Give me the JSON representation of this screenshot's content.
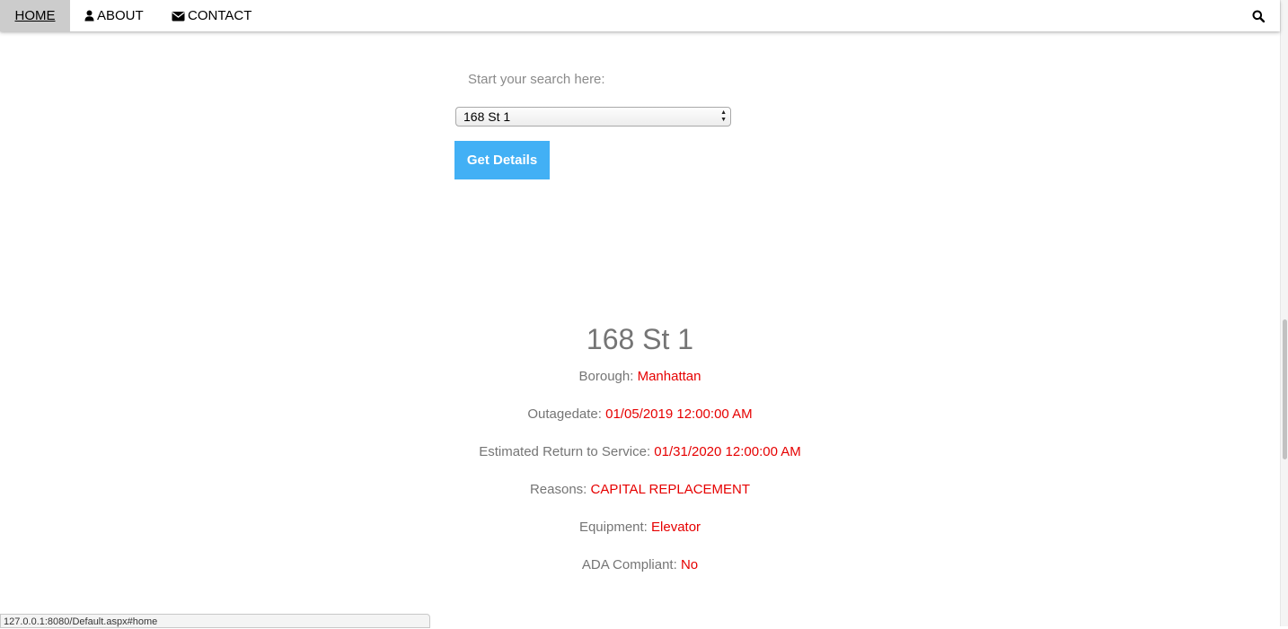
{
  "nav": {
    "home": "HOME",
    "about": "ABOUT",
    "contact": "CONTACT"
  },
  "search": {
    "label": "Start your search here:",
    "selected_station": "168 St 1",
    "button_label": "Get Details"
  },
  "result": {
    "station": "168 St 1",
    "rows": [
      {
        "label": "Borough:",
        "value": "Manhattan"
      },
      {
        "label": "Outagedate:",
        "value": "01/05/2019 12:00:00 AM"
      },
      {
        "label": "Estimated Return to Service:",
        "value": "01/31/2020 12:00:00 AM"
      },
      {
        "label": "Reasons:",
        "value": "CAPITAL REPLACEMENT"
      },
      {
        "label": "Equipment:",
        "value": "Elevator"
      },
      {
        "label": "ADA Compliant:",
        "value": "No"
      }
    ]
  },
  "status_bar": {
    "url": "127.0.0.1:8080/Default.aspx#home"
  },
  "colors": {
    "accent_button": "#42b0f5",
    "value_text": "#e60000",
    "label_text": "#757575",
    "nav_active_bg": "#cccccc"
  },
  "icons": {
    "about": "user-icon",
    "contact": "envelope-icon",
    "search": "search-icon",
    "select": "select-arrows-icon"
  }
}
